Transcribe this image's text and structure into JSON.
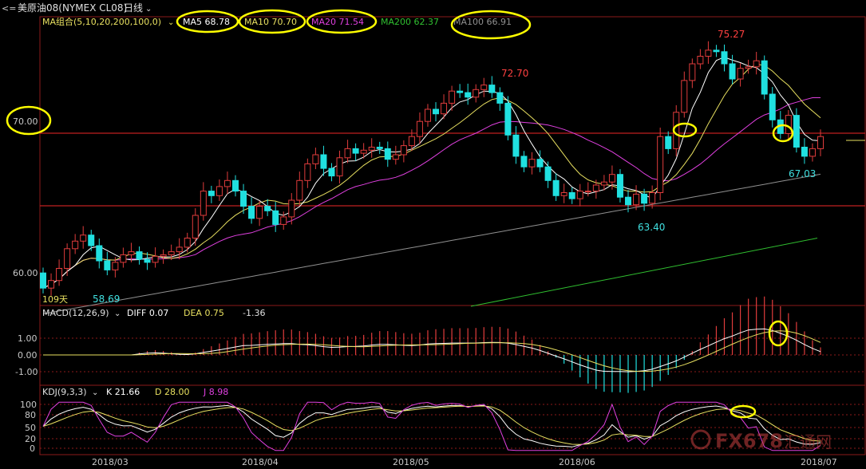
{
  "colors": {
    "bg": "#000000",
    "frame": "#8b1a1a",
    "ref_line": "#c02020",
    "axis_text": "#c8c8c8",
    "up": "#e03c3c",
    "down": "#20e0e0",
    "ma5": "#ffffff",
    "ma10": "#e8e060",
    "ma20": "#e040e0",
    "ma100": "#909090",
    "ma200": "#30c030",
    "ellipse": "#ffff00",
    "hi_label": "#ff4040",
    "lo_label": "#40e0e0"
  },
  "header": {
    "back_icon": "back-arrow-icon",
    "title": "美原油08(NYMEX CL08)",
    "period": "日线",
    "dropdown_icon": "chevron-down-icon"
  },
  "ma_bar": {
    "label": "MA组合(5,10,20,200,100,0)",
    "dropdown_icon": "chevron-down-icon",
    "items": [
      {
        "text": "MA5 68.78",
        "color": "#ffffff",
        "circled": true
      },
      {
        "text": "MA10 70.70",
        "color": "#e8e060",
        "circled": true
      },
      {
        "text": "MA20 71.54",
        "color": "#e040e0",
        "circled": true
      },
      {
        "text": "MA200 62.37",
        "color": "#30c030",
        "circled": false
      },
      {
        "text": "MA100 66.91",
        "color": "#909090",
        "circled": true
      }
    ]
  },
  "price_axis": {
    "labels": [
      "70.00",
      "60.00"
    ]
  },
  "annotations": {
    "high1": "72.70",
    "high2": "75.27",
    "low1": "58.69",
    "low2": "63.40",
    "last": "67.03",
    "days": "109天"
  },
  "macd": {
    "label": "MACD(12,26,9)",
    "dropdown_icon": "chevron-down-icon",
    "diff": "DIFF 0.07",
    "dea": "DEA 0.75",
    "macd_val": "-1.36",
    "axis": [
      "1.00",
      "0.00",
      "-1.00"
    ]
  },
  "kdj": {
    "label": "KDJ(9,3,3)",
    "dropdown_icon": "chevron-down-icon",
    "k": "K 21.66",
    "d": "D 28.00",
    "j": "J 8.98",
    "axis": [
      "100",
      "80",
      "50",
      "20",
      "0"
    ]
  },
  "x_axis": {
    "labels": [
      "2018/03",
      "2018/04",
      "2018/05",
      "2018/06",
      "2018/07"
    ]
  },
  "watermark": {
    "text": "FX678",
    "sub": "汇通网"
  },
  "chart_data": {
    "type": "candlestick",
    "y_label_price_levels": [
      60.0,
      70.0
    ],
    "visible_extremes": {
      "low": 58.69,
      "high1": 72.7,
      "low2": 63.4,
      "high2": 75.27,
      "last_low": 67.03
    },
    "closes": [
      59.2,
      59.7,
      60.5,
      61.8,
      62.3,
      62.7,
      62.0,
      61.0,
      60.4,
      60.9,
      61.4,
      61.6,
      61.1,
      60.9,
      61.3,
      61.4,
      61.6,
      61.9,
      62.5,
      64.0,
      65.6,
      65.3,
      65.9,
      66.3,
      65.6,
      64.6,
      63.8,
      64.6,
      64.3,
      63.4,
      63.9,
      65.0,
      66.3,
      67.4,
      68.0,
      67.1,
      66.6,
      67.8,
      68.4,
      68.1,
      68.3,
      68.5,
      68.4,
      67.7,
      68.0,
      68.6,
      69.2,
      70.2,
      71.0,
      70.7,
      71.4,
      72.2,
      72.1,
      71.8,
      72.3,
      72.6,
      72.1,
      71.4,
      69.3,
      67.9,
      67.2,
      67.7,
      67.2,
      66.3,
      65.3,
      65.5,
      65.1,
      65.6,
      65.6,
      66.0,
      66.2,
      66.7,
      65.2,
      64.7,
      65.4,
      64.8,
      65.5,
      69.2,
      68.4,
      70.8,
      72.9,
      74.0,
      74.5,
      74.9,
      74.8,
      74.0,
      73.0,
      73.7,
      73.8,
      74.2,
      72.0,
      70.3,
      69.4,
      70.6,
      68.5,
      67.9,
      68.4,
      69.2
    ],
    "opens": [
      60.2,
      59.2,
      59.7,
      60.5,
      61.8,
      62.3,
      62.7,
      62.0,
      61.0,
      60.4,
      60.9,
      61.4,
      61.6,
      61.1,
      60.9,
      61.3,
      61.4,
      61.6,
      61.9,
      62.5,
      64.0,
      65.6,
      65.3,
      65.9,
      66.3,
      65.6,
      64.6,
      63.8,
      64.6,
      64.3,
      63.4,
      63.9,
      65.0,
      66.3,
      67.4,
      68.0,
      67.1,
      66.6,
      67.8,
      68.4,
      68.1,
      68.3,
      68.5,
      68.4,
      67.7,
      68.0,
      68.6,
      69.2,
      70.2,
      71.0,
      70.7,
      71.4,
      72.2,
      72.1,
      71.8,
      72.3,
      72.6,
      72.1,
      71.4,
      69.3,
      67.9,
      67.2,
      67.7,
      67.2,
      66.3,
      65.3,
      65.5,
      65.1,
      65.6,
      65.6,
      66.0,
      66.2,
      66.7,
      65.2,
      64.7,
      65.4,
      64.8,
      65.5,
      69.2,
      68.4,
      70.8,
      72.9,
      74.0,
      74.5,
      74.9,
      74.8,
      74.0,
      73.0,
      73.7,
      73.8,
      74.2,
      72.0,
      70.3,
      69.4,
      70.6,
      68.5,
      67.9,
      68.4
    ]
  }
}
